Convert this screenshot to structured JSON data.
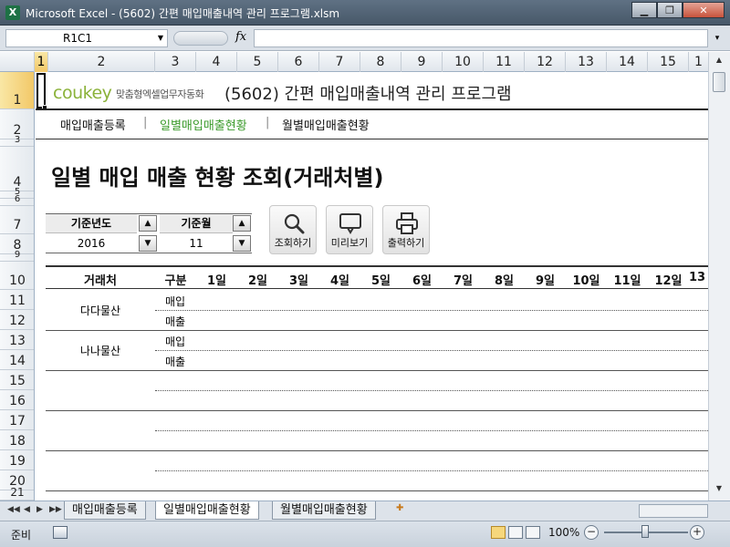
{
  "window": {
    "title": "Microsoft Excel - (5602) 간편 매입매출내역 관리 프로그램.xlsm",
    "app_icon": "excel-icon",
    "minimize_glyph": "▁",
    "restore_glyph": "❐",
    "close_glyph": "✕"
  },
  "formula_bar": {
    "name_box": "R1C1",
    "fx_label": "fx",
    "formula": ""
  },
  "columns": [
    "1",
    "2",
    "3",
    "4",
    "5",
    "6",
    "7",
    "8",
    "9",
    "10",
    "11",
    "12",
    "13",
    "14",
    "15",
    "1"
  ],
  "rows": [
    "1",
    "2",
    "3",
    "4",
    "5",
    "6",
    "7",
    "8",
    "9",
    "10",
    "11",
    "12",
    "13",
    "14",
    "15",
    "16",
    "17",
    "18",
    "19",
    "20",
    "21"
  ],
  "sheet": {
    "brand": "coukey",
    "brand_sub": "맞춤형엑셀업무자동화",
    "app_title": "(5602) 간편 매입매출내역 관리 프로그램",
    "nav": [
      "매입매출등록",
      "일별매입매출현황",
      "월별매입매출현황"
    ],
    "nav_separator": "|",
    "heading": "일별 매입 매출 현황 조회(거래처별)",
    "controls": {
      "year_label": "기준년도",
      "year_value": "2016",
      "month_label": "기준월",
      "month_value": "11",
      "spin_up": "▲",
      "spin_down": "▼"
    },
    "buttons": [
      "조회하기",
      "미리보기",
      "출력하기"
    ],
    "table": {
      "headers": [
        "거래처",
        "구분",
        "1일",
        "2일",
        "3일",
        "4일",
        "5일",
        "6일",
        "7일",
        "8일",
        "9일",
        "10일",
        "11일",
        "12일",
        "13"
      ],
      "rows": [
        {
          "vendor": "다다물산",
          "types": [
            "매입",
            "매출"
          ]
        },
        {
          "vendor": "나나물산",
          "types": [
            "매입",
            "매출"
          ]
        }
      ]
    }
  },
  "tabs": {
    "items": [
      "매입매출등록",
      "일별매입매출현황",
      "월별매입매출현황"
    ],
    "active_index": 1,
    "nav_arrows": [
      "◀◀",
      "◀",
      "▶",
      "▶▶"
    ]
  },
  "status": {
    "ready": "준비",
    "zoom": "100%",
    "zoom_minus": "−",
    "zoom_plus": "+"
  },
  "colors": {
    "brand_green": "#8bb23a",
    "active_nav": "#3a9a2a",
    "excel_green": "#1e7145"
  }
}
